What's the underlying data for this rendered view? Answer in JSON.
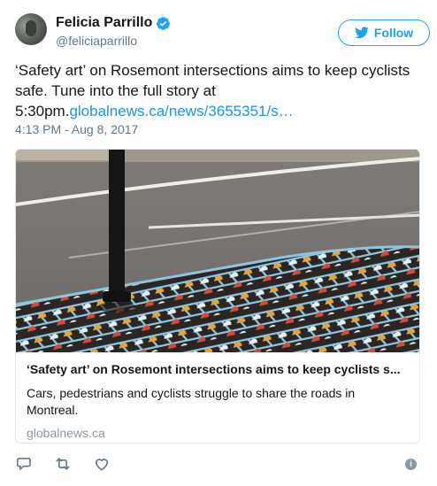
{
  "user": {
    "name": "Felicia Parrillo",
    "handle": "@feliciaparrillo"
  },
  "follow_button": {
    "label": "Follow"
  },
  "tweet": {
    "text_plain": "‘Safety art’ on Rosemont intersections aims to keep cyclists safe. Tune into the full story at 5:30pm.",
    "link_text": "globalnews.ca/news/3655351/s…",
    "timestamp": "4:13 PM - Aug 8, 2017"
  },
  "card": {
    "title": "‘Safety art’ on Rosemont intersections aims to keep cyclists s...",
    "description": "Cars, pedestrians and cyclists struggle to share the roads in Montreal.",
    "domain": "globalnews.ca"
  },
  "actions": {
    "icons": [
      "reply-icon",
      "retweet-icon",
      "like-icon",
      "info-icon"
    ]
  },
  "colors": {
    "brand_blue": "#1da1f2",
    "link_blue": "#1b95e0",
    "secondary_text": "#657786",
    "border": "#e1e8ed"
  }
}
